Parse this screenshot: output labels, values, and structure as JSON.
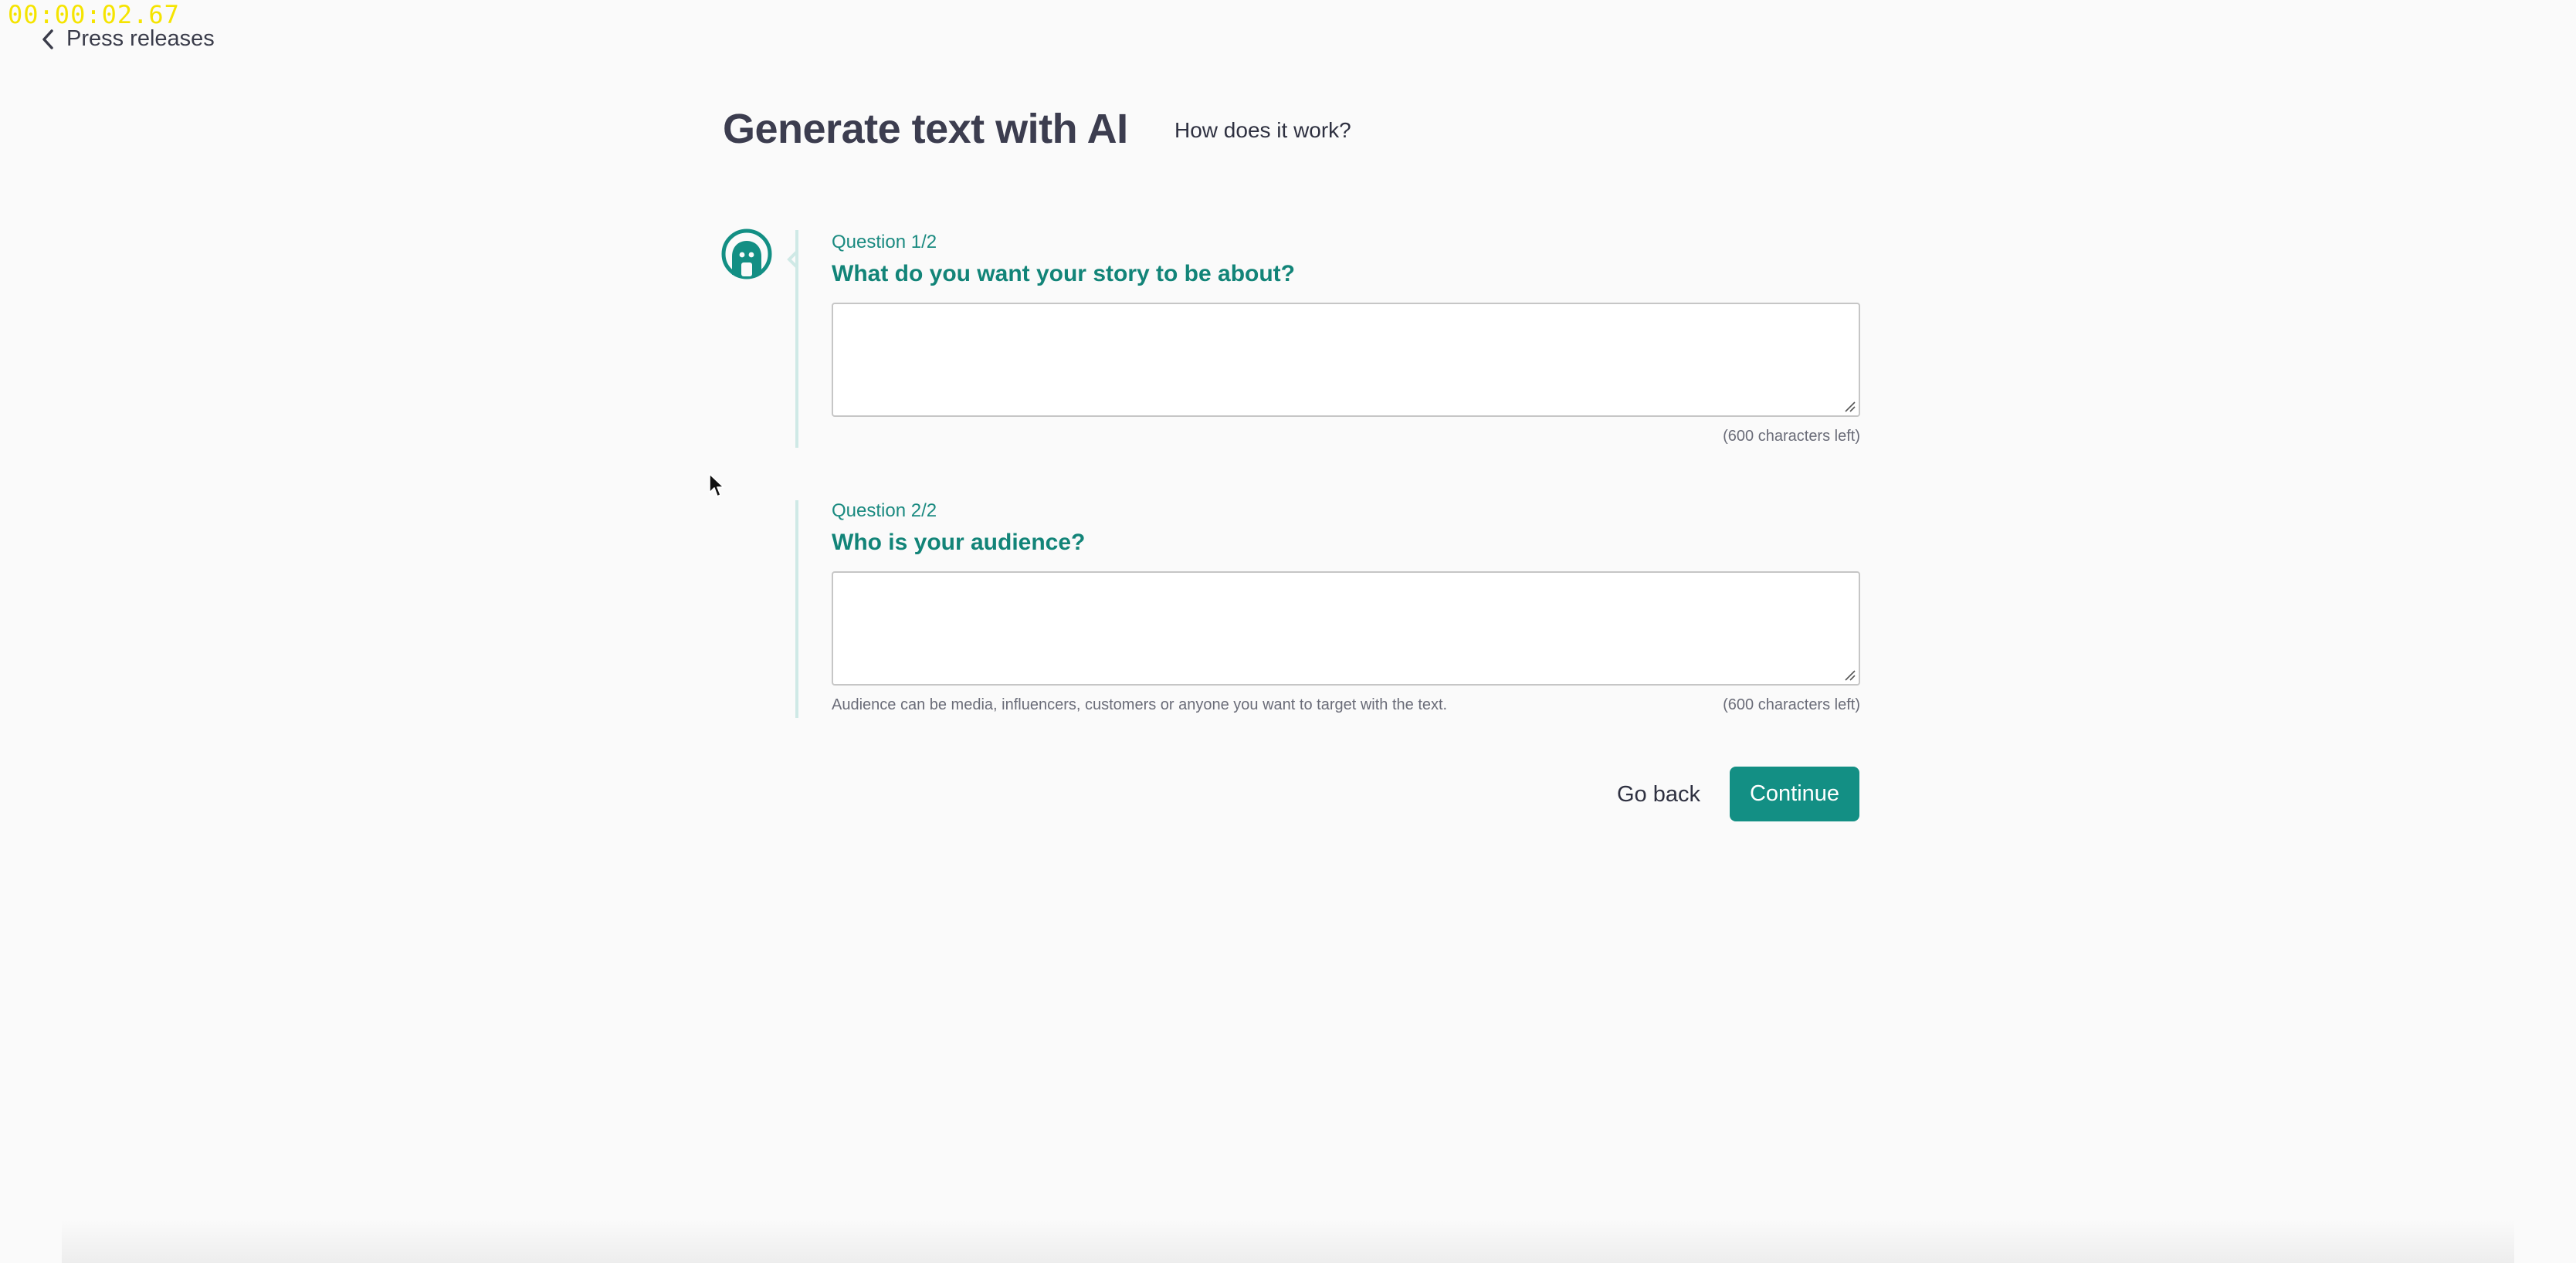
{
  "recording": {
    "timestamp": "00:00:02.67",
    "timestamp_color": "#f5e400"
  },
  "nav": {
    "back_label": "Press releases",
    "back_icon": "chevron-left-icon"
  },
  "header": {
    "title": "Generate text with AI",
    "help_link": "How does it work?"
  },
  "assistant": {
    "avatar_icon": "ai-assistant-avatar-icon"
  },
  "questions": [
    {
      "label": "Question 1/2",
      "title": "What do you want your story to be about?",
      "value": "",
      "helper": "",
      "chars_left": "(600 characters left)"
    },
    {
      "label": "Question 2/2",
      "title": "Who is your audience?",
      "value": "",
      "helper": "Audience can be media, influencers, customers or anyone you want to target with the text.",
      "chars_left": "(600 characters left)"
    }
  ],
  "actions": {
    "go_back": "Go back",
    "continue": "Continue"
  },
  "colors": {
    "accent": "#138f84",
    "question_text": "#128478",
    "rail": "#cfe9e6",
    "title": "#3c3d4f",
    "background": "#fafafa"
  }
}
